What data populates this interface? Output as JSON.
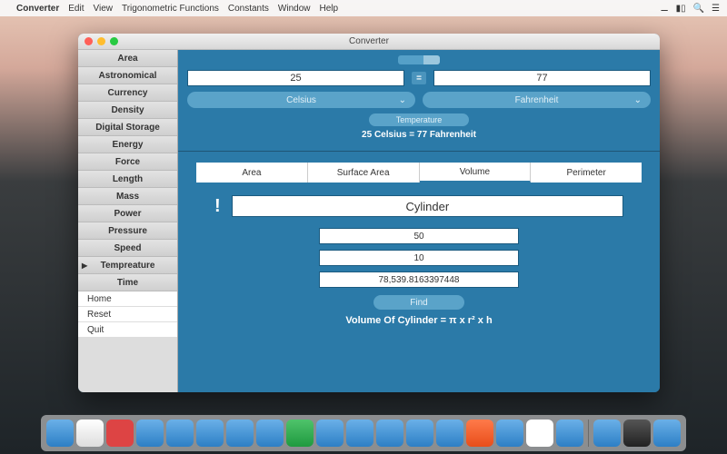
{
  "menubar": {
    "app": "Converter",
    "items": [
      "Edit",
      "View",
      "Trigonometric Functions",
      "Constants",
      "Window",
      "Help"
    ]
  },
  "window": {
    "title": "Converter"
  },
  "sidebar": {
    "items": [
      "Area",
      "Astronomical",
      "Currency",
      "Density",
      "Digital Storage",
      "Energy",
      "Force",
      "Length",
      "Mass",
      "Power",
      "Pressure",
      "Speed",
      "Tempreature",
      "Time"
    ],
    "selected": 12,
    "links": [
      "Home",
      "Reset",
      "Quit"
    ]
  },
  "converter": {
    "left_value": "25",
    "right_value": "77",
    "left_unit": "Celsius",
    "right_unit": "Fahrenheit",
    "category": "Temperature",
    "result": "25 Celsius = 77 Fahrenheit"
  },
  "geometry": {
    "tabs": [
      "Area",
      "Surface Area",
      "Volume",
      "Perimeter"
    ],
    "active_tab": 2,
    "shape": "Cylinder",
    "input1": "50",
    "input2": "10",
    "output": "78,539.8163397448",
    "button": "Find",
    "formula": "Volume Of Cylinder = π x r² x h"
  }
}
